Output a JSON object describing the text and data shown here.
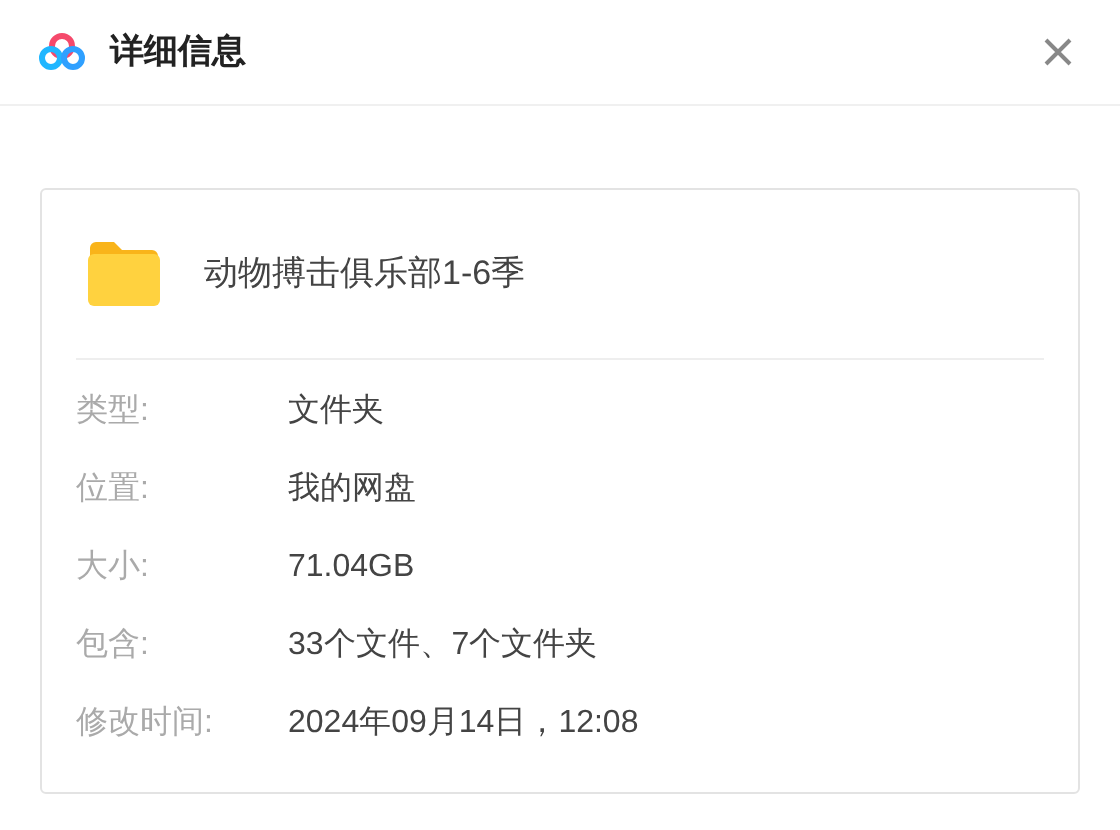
{
  "dialog": {
    "title": "详细信息"
  },
  "item": {
    "name": "动物搏击俱乐部1-6季",
    "kind": "folder"
  },
  "details": [
    {
      "label": "类型:",
      "value": "文件夹"
    },
    {
      "label": "位置:",
      "value": "我的网盘"
    },
    {
      "label": "大小:",
      "value": "71.04GB"
    },
    {
      "label": "包含:",
      "value": "33个文件、7个文件夹"
    },
    {
      "label": "修改时间:",
      "value": "2024年09月14日，12:08"
    }
  ]
}
